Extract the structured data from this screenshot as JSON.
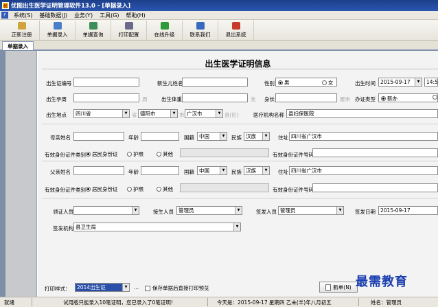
{
  "window": {
    "title": "优图出生医学证明管理软件13.0 - [单据录入]"
  },
  "menu": [
    {
      "label": "系统(S)"
    },
    {
      "label": "基础数据(J)"
    },
    {
      "label": "业务(Y)"
    },
    {
      "label": "工具(G)"
    },
    {
      "label": "帮助(H)"
    }
  ],
  "toolbar": [
    {
      "label": "正新注册",
      "icon": "register-icon",
      "color": "#c89a2a"
    },
    {
      "label": "单据录入",
      "icon": "document-entry-icon",
      "color": "#4b7ec8"
    },
    {
      "label": "单据查询",
      "icon": "search-icon",
      "color": "#3c8f5a"
    },
    {
      "label": "打印配置",
      "icon": "printer-icon",
      "color": "#6a6a8a"
    },
    {
      "label": "在线升级",
      "icon": "upgrade-icon",
      "color": "#2f9a3a"
    },
    {
      "label": "联系我们",
      "icon": "contact-icon",
      "color": "#3a6ac0"
    },
    {
      "label": "退出系统",
      "icon": "exit-icon",
      "color": "#c83a2a"
    }
  ],
  "tab": {
    "label": "单据录入"
  },
  "form": {
    "title": "出生医学证明信息",
    "cert_no_label": "出生证编号",
    "baby_name_label": "新生儿姓名",
    "gender_label": "性别",
    "gender_male": "男",
    "gender_female": "女",
    "birth_time_label": "出生时间",
    "birth_date": "2015-09-17",
    "birth_clock": "14:50",
    "gest_label": "出生孕周",
    "gest_unit": "周",
    "weight_label": "出生体重",
    "weight_unit": "克",
    "height_label": "身长",
    "height_unit": "厘米",
    "type_label": "办证类型",
    "type_new": "新办",
    "place_label": "出生地点",
    "province": "四川省",
    "province_unit": "省",
    "city": "德阳市",
    "city_unit": "市",
    "county": "广汉市",
    "county_unit": "县(区)",
    "hospital_label": "医疗机构名称",
    "hospital": "县妇保医院",
    "mother_name_label": "母亲姓名",
    "age_label": "年龄",
    "nationality_label": "国籍",
    "nationality": "中国",
    "ethnic_label": "民族",
    "ethnic": "汉族",
    "address_label": "住址",
    "address": "四川省广汉市",
    "id_type_label": "有效身份证件类别",
    "id_resident": "居民身份证",
    "id_passport": "护照",
    "id_other": "其他",
    "id_no_label": "有效身份证件号码",
    "father_name_label": "父亲姓名",
    "receiver_label": "领证人员",
    "midwife_label": "接生人员",
    "midwife": "管理员",
    "issuer_label": "签发人员",
    "issuer": "管理员",
    "issue_date_label": "签发日期",
    "issue_date": "2015-09-17",
    "org_label": "签发机构",
    "org": "县卫生局",
    "print_style_label": "打印样式：",
    "print_style": "2014出生证",
    "more": "...",
    "save_print_label": "保存单据后直接打印预览",
    "new_button": "新单(N)"
  },
  "status": {
    "ready": "就绪",
    "trial": "试用版只能录入10笔证明，您已录入了0笔证明!",
    "today": "今天是：2015-09-17 星期四 乙未(羊)年八月初五",
    "user": "姓名：管理员"
  },
  "watermark": "最需教育"
}
